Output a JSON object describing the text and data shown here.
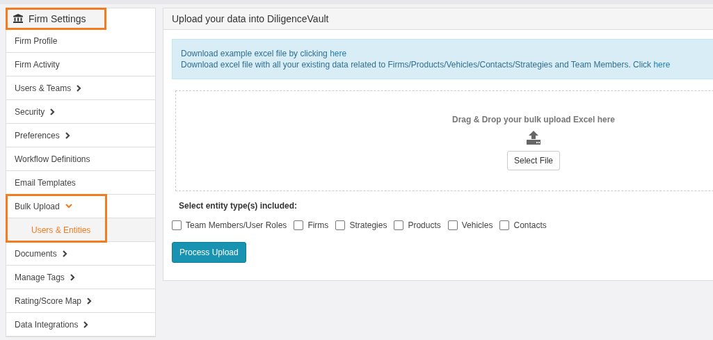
{
  "sidebar": {
    "title": "Firm Settings",
    "highlighted": true,
    "items": [
      {
        "label": "Firm Profile",
        "kind": "link",
        "highlighted": false
      },
      {
        "label": "Firm Activity",
        "kind": "link",
        "highlighted": false
      },
      {
        "label": "Users & Teams",
        "kind": "group",
        "expanded": false,
        "highlighted": false
      },
      {
        "label": "Security",
        "kind": "group",
        "expanded": false,
        "highlighted": false
      },
      {
        "label": "Preferences",
        "kind": "group",
        "expanded": false,
        "highlighted": false
      },
      {
        "label": "Workflow Definitions",
        "kind": "link",
        "highlighted": false
      },
      {
        "label": "Email Templates",
        "kind": "link",
        "highlighted": false
      },
      {
        "label": "Bulk Upload",
        "kind": "group",
        "expanded": true,
        "highlighted": true,
        "children": [
          {
            "label": "Users & Entities",
            "selected": true
          }
        ]
      },
      {
        "label": "Documents",
        "kind": "group",
        "expanded": false,
        "highlighted": false
      },
      {
        "label": "Manage Tags",
        "kind": "group",
        "expanded": false,
        "highlighted": false
      },
      {
        "label": "Rating/Score Map",
        "kind": "group",
        "expanded": false,
        "highlighted": false
      },
      {
        "label": "Data Integrations",
        "kind": "group",
        "expanded": false,
        "highlighted": false
      }
    ]
  },
  "panel": {
    "title": "Upload your data into DiligenceVault",
    "info_lines": [
      {
        "text": "Download example excel file by clicking",
        "link": "here"
      },
      {
        "text": "Download excel file with all your existing data related to Firms/Products/Vehicles/Contacts/Strategies and Team Members. Click",
        "link": "here"
      }
    ],
    "dropzone": {
      "text": "Drag & Drop your bulk upload Excel here",
      "button": "Select File"
    },
    "entity_label": "Select entity type(s) included:",
    "entities": [
      {
        "label": "Team Members/User Roles",
        "checked": false
      },
      {
        "label": "Firms",
        "checked": false
      },
      {
        "label": "Strategies",
        "checked": false
      },
      {
        "label": "Products",
        "checked": false
      },
      {
        "label": "Vehicles",
        "checked": false
      },
      {
        "label": "Contacts",
        "checked": false
      }
    ],
    "submit": "Process Upload"
  }
}
